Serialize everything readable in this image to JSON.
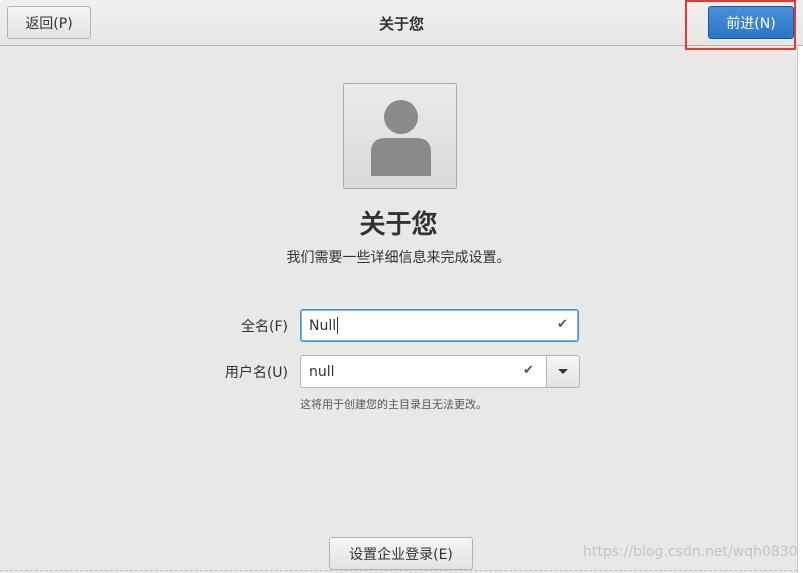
{
  "header": {
    "title": "关于您",
    "back_label": "返回(P)",
    "next_label": "前进(N)"
  },
  "main": {
    "heading": "关于您",
    "subtitle": "我们需要一些详细信息来完成设置。",
    "avatar_icon": "user-avatar-icon"
  },
  "form": {
    "fullname_label": "全名(F)",
    "fullname_value": "Null",
    "username_label": "用户名(U)",
    "username_value": "null",
    "username_hint": "这将用于创建您的主目录且无法更改。",
    "valid_icon": "✔"
  },
  "footer": {
    "enterprise_label": "设置企业登录(E)",
    "watermark": "https://blog.csdn.net/wqh0830"
  },
  "colors": {
    "accent": "#4a90d9",
    "highlight": "#e53935"
  }
}
